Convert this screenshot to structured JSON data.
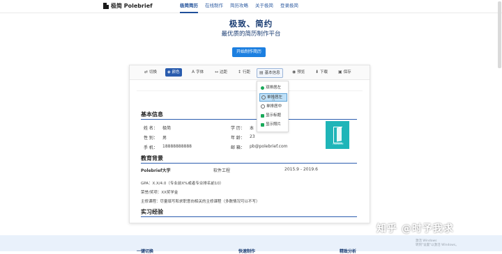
{
  "header": {
    "brand": "极简 Polebrief",
    "nav": [
      {
        "label": "极简简历",
        "active": true
      },
      {
        "label": "在线制作",
        "active": false
      },
      {
        "label": "简历攻略",
        "active": false
      },
      {
        "label": "关于极简",
        "active": false
      },
      {
        "label": "登录极简",
        "active": false
      }
    ]
  },
  "hero": {
    "title": "极致、简约",
    "subtitle": "最优质的简历制作平台",
    "cta": "开始制作简历"
  },
  "toolbar": {
    "items": [
      {
        "icon": "⇄",
        "label": "切换",
        "name": "switch"
      },
      {
        "icon": "◈",
        "label": "颜色",
        "name": "color",
        "active": true
      },
      {
        "icon": "A",
        "label": "字体",
        "name": "font"
      },
      {
        "icon": "↔",
        "label": "边距",
        "name": "margin"
      },
      {
        "icon": "↕",
        "label": "行距",
        "name": "line-spacing"
      },
      {
        "icon": "▤",
        "label": "基本信息",
        "name": "basic-info",
        "open": true
      },
      {
        "icon": "◉",
        "label": "预览",
        "name": "preview"
      },
      {
        "icon": "⬇",
        "label": "下载",
        "name": "download"
      },
      {
        "icon": "▣",
        "label": "保存",
        "name": "save"
      }
    ]
  },
  "dropdown": {
    "items": [
      {
        "label": "双排居左",
        "state": "on"
      },
      {
        "label": "单排居左",
        "state": "highlight"
      },
      {
        "label": "单排居中",
        "state": "off"
      },
      {
        "label": "显示标题",
        "state": "square"
      },
      {
        "label": "显示照片",
        "state": "square"
      }
    ]
  },
  "resume": {
    "basic": {
      "heading": "基本信息",
      "name_k": "姓 名：",
      "name_v": "极简",
      "edu_k": "学 历：",
      "edu_v": "本",
      "gender_k": "性 别：",
      "gender_v": "男",
      "age_k": "年 龄：",
      "age_v": "23",
      "phone_k": "手 机：",
      "phone_v": "18888888888",
      "email_k": "邮 箱：",
      "email_v": "pb@polebrief.com",
      "photo_caption": "Polebrief"
    },
    "education": {
      "heading": "教育背景",
      "school": "Polebrief大学",
      "major": "软件工程",
      "period": "2015.9 - 2019.6",
      "gpa": "GPA：X.X/4.0（专业前X%或者专业排名前10）",
      "honors": "荣誉/奖项：XX奖学金",
      "courses": "主修课程：尽量填写和求职意向相关的主修课程（多数情况可以不写）"
    },
    "experience": {
      "heading": "实习经验"
    }
  },
  "footer": {
    "items": [
      "一键切换",
      "快速制作",
      "精致分析"
    ],
    "watermark": "知乎 @时予我求",
    "win_note_1": "激活 Windows",
    "win_note_2": "转到\"设置\"以激活 Windows。"
  }
}
